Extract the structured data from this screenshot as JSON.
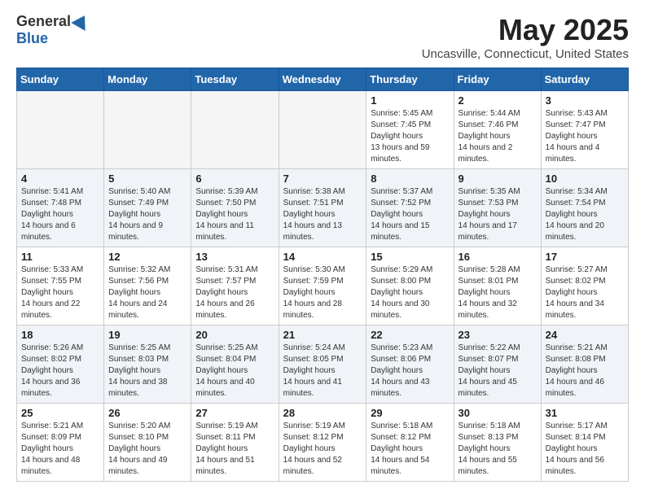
{
  "header": {
    "logo": {
      "general": "General",
      "blue": "Blue"
    },
    "title": "May 2025",
    "subtitle": "Uncasville, Connecticut, United States"
  },
  "weekdays": [
    "Sunday",
    "Monday",
    "Tuesday",
    "Wednesday",
    "Thursday",
    "Friday",
    "Saturday"
  ],
  "weeks": [
    [
      {
        "day": "",
        "sunrise": "",
        "sunset": "",
        "daylight": ""
      },
      {
        "day": "",
        "sunrise": "",
        "sunset": "",
        "daylight": ""
      },
      {
        "day": "",
        "sunrise": "",
        "sunset": "",
        "daylight": ""
      },
      {
        "day": "",
        "sunrise": "",
        "sunset": "",
        "daylight": ""
      },
      {
        "day": "1",
        "sunrise": "5:45 AM",
        "sunset": "7:45 PM",
        "daylight": "13 hours and 59 minutes."
      },
      {
        "day": "2",
        "sunrise": "5:44 AM",
        "sunset": "7:46 PM",
        "daylight": "14 hours and 2 minutes."
      },
      {
        "day": "3",
        "sunrise": "5:43 AM",
        "sunset": "7:47 PM",
        "daylight": "14 hours and 4 minutes."
      }
    ],
    [
      {
        "day": "4",
        "sunrise": "5:41 AM",
        "sunset": "7:48 PM",
        "daylight": "14 hours and 6 minutes."
      },
      {
        "day": "5",
        "sunrise": "5:40 AM",
        "sunset": "7:49 PM",
        "daylight": "14 hours and 9 minutes."
      },
      {
        "day": "6",
        "sunrise": "5:39 AM",
        "sunset": "7:50 PM",
        "daylight": "14 hours and 11 minutes."
      },
      {
        "day": "7",
        "sunrise": "5:38 AM",
        "sunset": "7:51 PM",
        "daylight": "14 hours and 13 minutes."
      },
      {
        "day": "8",
        "sunrise": "5:37 AM",
        "sunset": "7:52 PM",
        "daylight": "14 hours and 15 minutes."
      },
      {
        "day": "9",
        "sunrise": "5:35 AM",
        "sunset": "7:53 PM",
        "daylight": "14 hours and 17 minutes."
      },
      {
        "day": "10",
        "sunrise": "5:34 AM",
        "sunset": "7:54 PM",
        "daylight": "14 hours and 20 minutes."
      }
    ],
    [
      {
        "day": "11",
        "sunrise": "5:33 AM",
        "sunset": "7:55 PM",
        "daylight": "14 hours and 22 minutes."
      },
      {
        "day": "12",
        "sunrise": "5:32 AM",
        "sunset": "7:56 PM",
        "daylight": "14 hours and 24 minutes."
      },
      {
        "day": "13",
        "sunrise": "5:31 AM",
        "sunset": "7:57 PM",
        "daylight": "14 hours and 26 minutes."
      },
      {
        "day": "14",
        "sunrise": "5:30 AM",
        "sunset": "7:59 PM",
        "daylight": "14 hours and 28 minutes."
      },
      {
        "day": "15",
        "sunrise": "5:29 AM",
        "sunset": "8:00 PM",
        "daylight": "14 hours and 30 minutes."
      },
      {
        "day": "16",
        "sunrise": "5:28 AM",
        "sunset": "8:01 PM",
        "daylight": "14 hours and 32 minutes."
      },
      {
        "day": "17",
        "sunrise": "5:27 AM",
        "sunset": "8:02 PM",
        "daylight": "14 hours and 34 minutes."
      }
    ],
    [
      {
        "day": "18",
        "sunrise": "5:26 AM",
        "sunset": "8:02 PM",
        "daylight": "14 hours and 36 minutes."
      },
      {
        "day": "19",
        "sunrise": "5:25 AM",
        "sunset": "8:03 PM",
        "daylight": "14 hours and 38 minutes."
      },
      {
        "day": "20",
        "sunrise": "5:25 AM",
        "sunset": "8:04 PM",
        "daylight": "14 hours and 40 minutes."
      },
      {
        "day": "21",
        "sunrise": "5:24 AM",
        "sunset": "8:05 PM",
        "daylight": "14 hours and 41 minutes."
      },
      {
        "day": "22",
        "sunrise": "5:23 AM",
        "sunset": "8:06 PM",
        "daylight": "14 hours and 43 minutes."
      },
      {
        "day": "23",
        "sunrise": "5:22 AM",
        "sunset": "8:07 PM",
        "daylight": "14 hours and 45 minutes."
      },
      {
        "day": "24",
        "sunrise": "5:21 AM",
        "sunset": "8:08 PM",
        "daylight": "14 hours and 46 minutes."
      }
    ],
    [
      {
        "day": "25",
        "sunrise": "5:21 AM",
        "sunset": "8:09 PM",
        "daylight": "14 hours and 48 minutes."
      },
      {
        "day": "26",
        "sunrise": "5:20 AM",
        "sunset": "8:10 PM",
        "daylight": "14 hours and 49 minutes."
      },
      {
        "day": "27",
        "sunrise": "5:19 AM",
        "sunset": "8:11 PM",
        "daylight": "14 hours and 51 minutes."
      },
      {
        "day": "28",
        "sunrise": "5:19 AM",
        "sunset": "8:12 PM",
        "daylight": "14 hours and 52 minutes."
      },
      {
        "day": "29",
        "sunrise": "5:18 AM",
        "sunset": "8:12 PM",
        "daylight": "14 hours and 54 minutes."
      },
      {
        "day": "30",
        "sunrise": "5:18 AM",
        "sunset": "8:13 PM",
        "daylight": "14 hours and 55 minutes."
      },
      {
        "day": "31",
        "sunrise": "5:17 AM",
        "sunset": "8:14 PM",
        "daylight": "14 hours and 56 minutes."
      }
    ]
  ]
}
